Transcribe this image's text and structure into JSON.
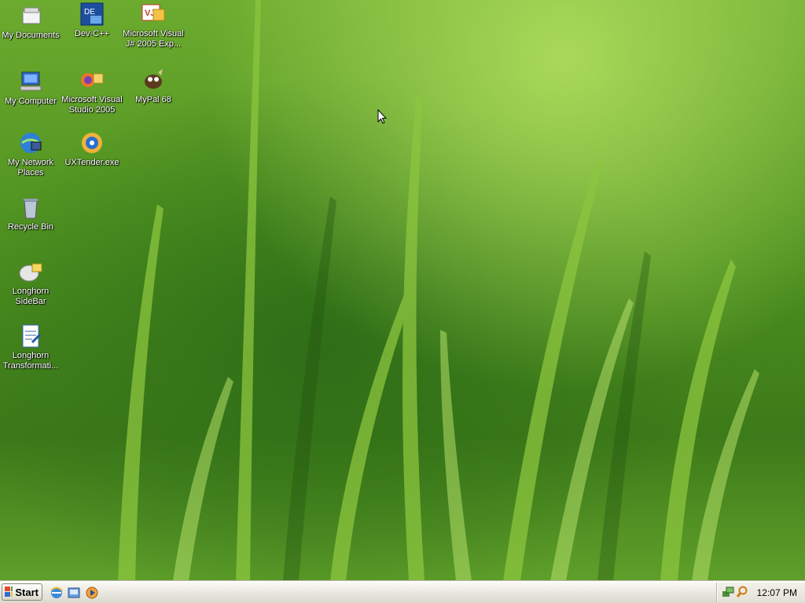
{
  "desktop": {
    "icons": [
      {
        "label": "My Documents",
        "icon": "my-documents-icon"
      },
      {
        "label": "Dev-C++",
        "icon": "dev-cpp-icon"
      },
      {
        "label": "Microsoft Visual J# 2005 Exp...",
        "icon": "visual-jsharp-icon"
      },
      {
        "label": "My Computer",
        "icon": "my-computer-icon"
      },
      {
        "label": "Microsoft Visual Studio 2005",
        "icon": "visual-studio-icon"
      },
      {
        "label": "MyPal 68",
        "icon": "mypal-icon"
      },
      {
        "label": "My Network Places",
        "icon": "network-places-icon"
      },
      {
        "label": "UXTender.exe",
        "icon": "uxtender-icon"
      },
      {
        "label": "Recycle Bin",
        "icon": "recycle-bin-icon"
      },
      {
        "label": "Longhorn SideBar",
        "icon": "longhorn-sidebar-icon"
      },
      {
        "label": "Longhorn Transformati...",
        "icon": "longhorn-transformation-icon"
      }
    ]
  },
  "taskbar": {
    "start_label": "Start",
    "quick_launch": [
      "internet-explorer-icon",
      "show-desktop-icon",
      "media-player-icon"
    ],
    "tray_icons": [
      "network-tray-icon",
      "search-tray-icon"
    ],
    "clock": "12:07 PM"
  },
  "colors": {
    "grass_light": "#a9d95a",
    "grass_dark": "#2f6e17",
    "taskbar": "#ecebe4"
  }
}
